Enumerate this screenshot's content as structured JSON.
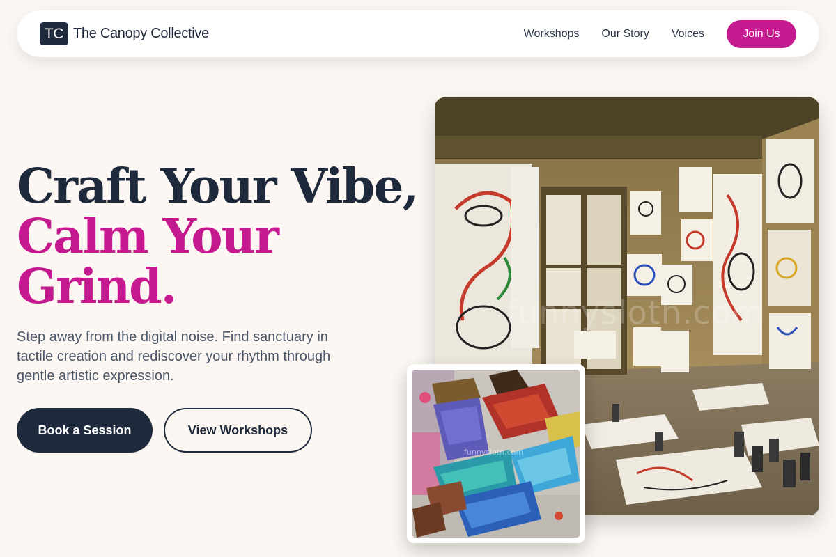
{
  "brand": {
    "mark": "TC",
    "name": "The Canopy Collective"
  },
  "nav": {
    "links": [
      "Workshops",
      "Our Story",
      "Voices"
    ],
    "cta": "Join Us"
  },
  "hero": {
    "headline_line1": "Craft Your Vibe,",
    "headline_line2": "Calm Your",
    "headline_line3": "Grind.",
    "subtext": "Step away from the digital noise. Find sanctuary in tactile creation and rediscover your rhythm through gentle artistic expression.",
    "primary_button": "Book a Session",
    "secondary_button": "View Workshops"
  },
  "images": {
    "main_watermark": "funnysloth.com",
    "inset_watermark": "funnysloth.com"
  },
  "colors": {
    "accent": "#c5198f",
    "dark": "#1e293b",
    "background": "#fcf7f2"
  },
  "icons": [
    "logo-mark-icon"
  ]
}
